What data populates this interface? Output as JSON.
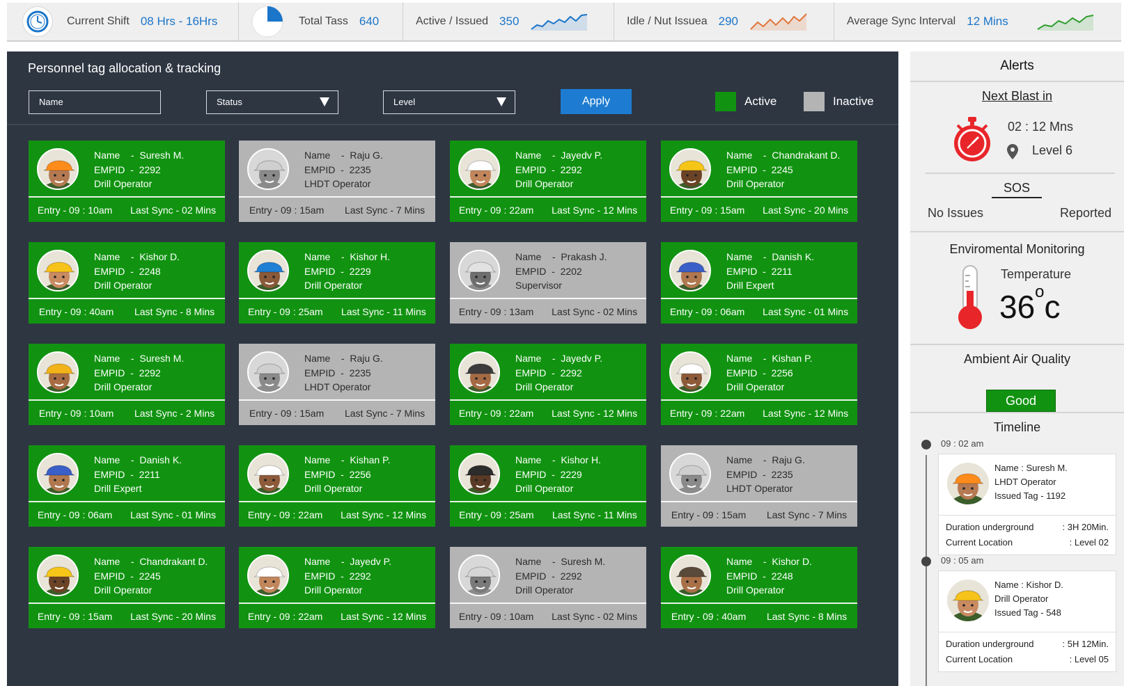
{
  "topbar": {
    "shift_label": "Current Shift",
    "shift_value": "08 Hrs - 16Hrs",
    "total_label": "Total Tass",
    "total_value": "640",
    "active_label": "Active / Issued",
    "active_value": "350",
    "idle_label": "Idle / Nut Issuea",
    "idle_value": "290",
    "sync_label": "Average Sync Interval",
    "sync_value": "12 Mins",
    "colors": {
      "active_spark": "#1b75c9",
      "idle_spark": "#e0763a",
      "sync_spark": "#2e9e2e"
    }
  },
  "panel": {
    "title": "Personnel tag allocation & tracking",
    "name_placeholder": "Name",
    "status_label": "Status",
    "level_label": "Level",
    "apply_label": "Apply",
    "legend_active": "Active",
    "legend_inactive": "Inactive",
    "colors": {
      "active": "#119311",
      "inactive": "#b4b4b4",
      "panel_bg": "#2e3642"
    }
  },
  "cards": [
    {
      "status": "active",
      "name": "Suresh M.",
      "empid": "2292",
      "role": "Drill Operator",
      "entry": "Entry - 09 : 10am",
      "sync": "Last Sync - 02 Mins",
      "helmet": "#ff8c1a",
      "skin": "#b57a52"
    },
    {
      "status": "inactive",
      "name": "Raju G.",
      "empid": "2235",
      "role": "LHDT Operator",
      "entry": "Entry - 09 : 15am",
      "sync": "Last Sync - 7 Mins",
      "helmet": "#cfcfcf",
      "skin": "#8a8a8a"
    },
    {
      "status": "active",
      "name": "Jayedv P.",
      "empid": "2292",
      "role": "Drill Operator",
      "entry": "Entry - 09 : 22am",
      "sync": "Last Sync - 12 Mins",
      "helmet": "#ffffff",
      "skin": "#c2865c"
    },
    {
      "status": "active",
      "name": "Chandrakant D.",
      "empid": "2245",
      "role": "Drill Operator",
      "entry": "Entry - 09 : 15am",
      "sync": "Last Sync - 20 Mins",
      "helmet": "#f5c518",
      "skin": "#6b4326"
    },
    {
      "status": "active",
      "name": "Kishor D.",
      "empid": "2248",
      "role": "Drill Operator",
      "entry": "Entry - 09 : 40am",
      "sync": "Last Sync - 8 Mins",
      "helmet": "#f7c21a",
      "skin": "#c98b62"
    },
    {
      "status": "active",
      "name": "Kishor H.",
      "empid": "2229",
      "role": "Drill Operator",
      "entry": "Entry - 09 : 25am",
      "sync": "Last Sync - 11 Mins",
      "helmet": "#1f7fd4",
      "skin": "#8a5a3a"
    },
    {
      "status": "inactive",
      "name": "Prakash J.",
      "empid": "2202",
      "role": "Supervisor",
      "entry": "Entry - 09 : 13am",
      "sync": "Last Sync - 02 Mins",
      "helmet": "#e2e2e2",
      "skin": "#6e6e6e"
    },
    {
      "status": "active",
      "name": "Danish K.",
      "empid": "2211",
      "role": "Drill Expert",
      "entry": "Entry - 09 : 06am",
      "sync": "Last Sync - 01 Mins",
      "helmet": "#3a5fc7",
      "skin": "#b07850"
    },
    {
      "status": "active",
      "name": "Suresh M.",
      "empid": "2292",
      "role": "Drill Operator",
      "entry": "Entry - 09 : 10am",
      "sync": "Last Sync - 2 Mins",
      "helmet": "#f2b21a",
      "skin": "#a86c44"
    },
    {
      "status": "inactive",
      "name": "Raju G.",
      "empid": "2235",
      "role": "LHDT Operator",
      "entry": "Entry - 09 : 15am",
      "sync": "Last Sync - 7 Mins",
      "helmet": "#cfcfcf",
      "skin": "#8a8a8a"
    },
    {
      "status": "active",
      "name": "Jayedv P.",
      "empid": "2292",
      "role": "Drill Operator",
      "entry": "Entry - 09 : 22am",
      "sync": "Last Sync - 12 Mins",
      "helmet": "#3b3b3b",
      "skin": "#a46a44"
    },
    {
      "status": "active",
      "name": "Kishan P.",
      "empid": "2256",
      "role": "Drill Operator",
      "entry": "Entry - 09 : 22am",
      "sync": "Last Sync - 12 Mins",
      "helmet": "#ffffff",
      "skin": "#8d5b3a"
    },
    {
      "status": "active",
      "name": "Danish K.",
      "empid": "2211",
      "role": "Drill Expert",
      "entry": "Entry - 09 : 06am",
      "sync": "Last Sync - 01 Mins",
      "helmet": "#3a5fc7",
      "skin": "#b07850"
    },
    {
      "status": "active",
      "name": "Kishan P.",
      "empid": "2256",
      "role": "Drill Operator",
      "entry": "Entry - 09 : 22am",
      "sync": "Last Sync - 12 Mins",
      "helmet": "#ffffff",
      "skin": "#8d5b3a"
    },
    {
      "status": "active",
      "name": "Kishor H.",
      "empid": "2229",
      "role": "Drill Operator",
      "entry": "Entry - 09 : 25am",
      "sync": "Last Sync - 11 Mins",
      "helmet": "#2c2c2c",
      "skin": "#5a3a26"
    },
    {
      "status": "inactive",
      "name": "Raju G.",
      "empid": "2235",
      "role": "LHDT Operator",
      "entry": "Entry - 09 : 15am",
      "sync": "Last Sync - 7 Mins",
      "helmet": "#cfcfcf",
      "skin": "#8a8a8a"
    },
    {
      "status": "active",
      "name": "Chandrakant D.",
      "empid": "2245",
      "role": "Drill Operator",
      "entry": "Entry - 09 : 15am",
      "sync": "Last Sync - 20 Mins",
      "helmet": "#f5c518",
      "skin": "#6b4326"
    },
    {
      "status": "active",
      "name": "Jayedv P.",
      "empid": "2292",
      "role": "Drill Operator",
      "entry": "Entry - 09 : 22am",
      "sync": "Last Sync - 12 Mins",
      "helmet": "#ffffff",
      "skin": "#c2865c"
    },
    {
      "status": "inactive",
      "name": "Suresh M.",
      "empid": "2292",
      "role": "Drill Operator",
      "entry": "Entry - 09 : 10am",
      "sync": "Last Sync - 02 Mins",
      "helmet": "#d6d6d6",
      "skin": "#7a7a7a"
    },
    {
      "status": "active",
      "name": "Kishor D.",
      "empid": "2248",
      "role": "Drill Operator",
      "entry": "Entry - 09 : 40am",
      "sync": "Last Sync - 8 Mins",
      "helmet": "#5a4a3a",
      "skin": "#a97048"
    }
  ],
  "card_labels": {
    "name": "Name",
    "empid": "EMPID",
    "dash": "-"
  },
  "sidebar": {
    "alerts_title": "Alerts",
    "next_blast_label": "Next Blast in",
    "blast_time": "02 : 12 Mns",
    "blast_level": "Level 6",
    "sos_title": "SOS",
    "sos_left": "No Issues",
    "sos_right": "Reported",
    "env_title": "Enviromental Monitoring",
    "temp_label": "Temperature",
    "temp_value": "36",
    "temp_degree": "o",
    "temp_unit": "c",
    "air_title": "Ambient Air Quality",
    "air_value": "Good",
    "timeline_title": "Timeline",
    "events": [
      {
        "time": "09 : 02 am",
        "name_line": "Name   : Suresh M.",
        "role": "LHDT Operator",
        "tag": "Issued Tag - 1192",
        "dur_label": "Duration underground",
        "dur_value": ": 3H 20Min.",
        "loc_label": "Current Location",
        "loc_value": ": Level 02",
        "helmet": "#ff8c1a",
        "skin": "#b57a52"
      },
      {
        "time": "09 : 05 am",
        "name_line": "Name   : Kishor D.",
        "role": "Drill Operator",
        "tag": "Issued Tag - 548",
        "dur_label": "Duration underground",
        "dur_value": ": 5H 12Min.",
        "loc_label": "Current Location",
        "loc_value": ": Level 05",
        "helmet": "#f7c21a",
        "skin": "#c98b62"
      }
    ]
  }
}
